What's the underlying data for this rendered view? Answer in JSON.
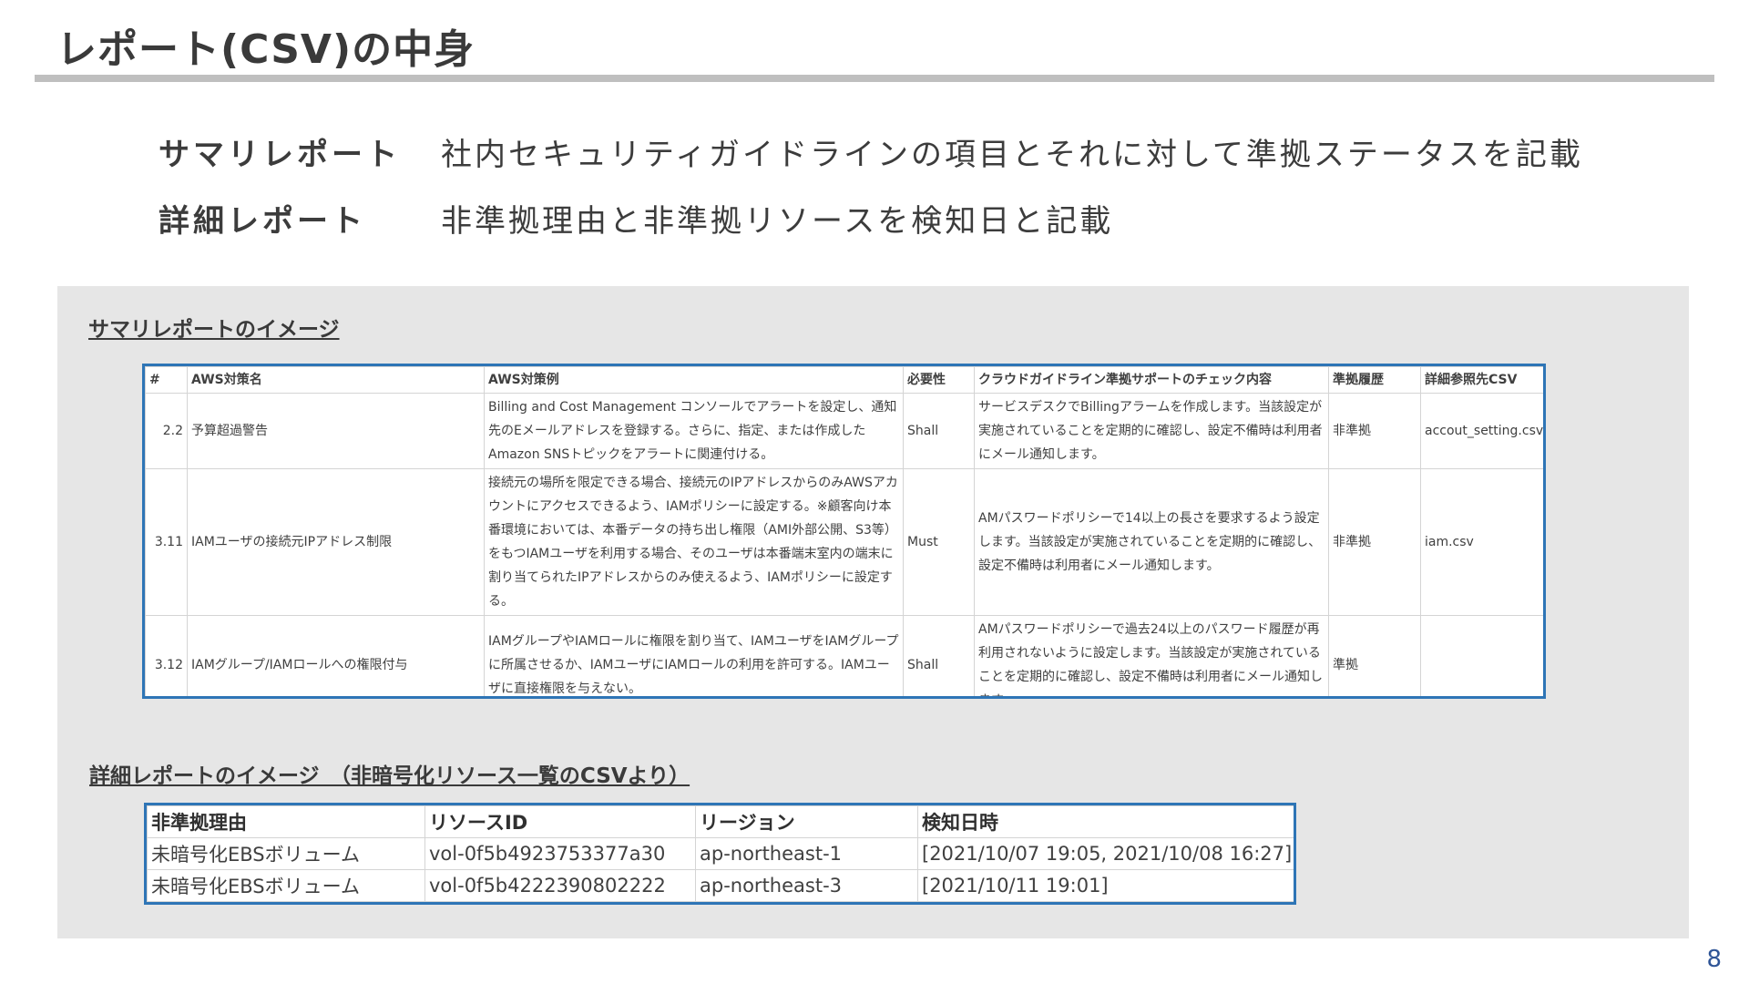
{
  "title": "レポート(CSV)の中身",
  "descriptions": [
    {
      "label": "サマリレポート",
      "text": "社内セキュリティガイドラインの項目とそれに対して準拠ステータスを記載"
    },
    {
      "label": "詳細レポート",
      "text": "非準拠理由と非準拠リソースを検知日と記載"
    }
  ],
  "summary": {
    "heading": "サマリレポートのイメージ",
    "columns": [
      "#",
      "AWS対策名",
      "AWS対策例",
      "必要性",
      "クラウドガイドライン準拠サポートのチェック内容",
      "準拠履歴",
      "詳細参照先CSV"
    ],
    "rows": [
      [
        "2.2",
        "予算超過警告",
        "Billing and Cost Management コンソールでアラートを設定し、通知先のEメールアドレスを登録する。さらに、指定、または作成したAmazon SNSトピックをアラートに関連付ける。",
        "Shall",
        "サービスデスクでBillingアラームを作成します。当該設定が実施されていることを定期的に確認し、設定不備時は利用者にメール通知します。",
        "非準拠",
        "accout_setting.csv"
      ],
      [
        "3.11",
        "IAMユーザの接続元IPアドレス制限",
        "接続元の場所を限定できる場合、接続元のIPアドレスからのみAWSアカウントにアクセスできるよう、IAMポリシーに設定する。※顧客向け本番環境においては、本番データの持ち出し権限（AMI外部公開、S3等）をもつIAMユーザを利用する場合、そのユーザは本番端末室内の端末に割り当てられたIPアドレスからのみ使えるよう、IAMポリシーに設定する。",
        "Must",
        "AMパスワードポリシーで14以上の長さを要求するよう設定します。当該設定が実施されていることを定期的に確認し、設定不備時は利用者にメール通知します。",
        "非準拠",
        "iam.csv"
      ],
      [
        "3.12",
        "IAMグループ/IAMロールへの権限付与",
        "IAMグループやIAMロールに権限を割り当て、IAMユーザをIAMグループに所属させるか、IAMユーザにIAMロールの利用を許可する。IAMユーザに直接権限を与えない。",
        "Shall",
        "AMパスワードポリシーで過去24以上のパスワード履歴が再利用されないように設定します。当該設定が実施されていることを定期的に確認し、設定不備時は利用者にメール通知します",
        "準拠",
        ""
      ]
    ]
  },
  "detail": {
    "heading": "詳細レポートのイメージ　（非暗号化リソース一覧のCSVより）",
    "columns": [
      "非準拠理由",
      "リソースID",
      "リージョン",
      "検知日時"
    ],
    "rows": [
      [
        "未暗号化EBSボリューム",
        "vol-0f5b4923753377a30",
        "ap-northeast-1",
        "[2021/10/07 19:05, 2021/10/08 16:27]"
      ],
      [
        "未暗号化EBSボリューム",
        "vol-0f5b4222390802222",
        "ap-northeast-3",
        "[2021/10/11 19:01]"
      ]
    ]
  },
  "page_number": "8",
  "colors": {
    "accent": "#2e75b6",
    "panel": "#e6e6e6",
    "rule": "#bfbfbf",
    "page_number": "#2f5597"
  }
}
